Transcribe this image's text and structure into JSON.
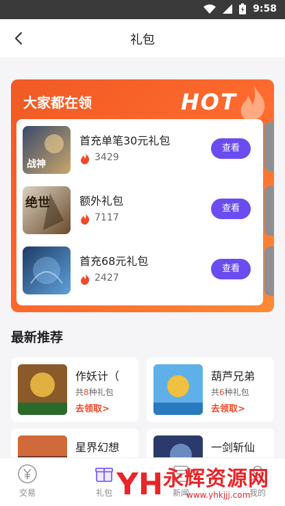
{
  "status_bar": {
    "time": "9:58"
  },
  "nav": {
    "title": "礼包"
  },
  "hot": {
    "heading": "大家都在领",
    "badge": "HOT",
    "items": [
      {
        "name": "首充单笔30元礼包",
        "count": "3429",
        "button": "查看",
        "art": "战神",
        "colors": [
          "#3b4a6b",
          "#c9a66b"
        ]
      },
      {
        "name": "额外礼包",
        "count": "7117",
        "button": "查看",
        "art": "绝世",
        "colors": [
          "#d9d2c2",
          "#6b4a2a"
        ]
      },
      {
        "name": "首充68元礼包",
        "count": "2427",
        "button": "查看",
        "art": "",
        "colors": [
          "#1d3b66",
          "#5fa0d8"
        ]
      }
    ]
  },
  "recommend": {
    "heading": "最新推荐",
    "items": [
      {
        "name": "作妖计（",
        "prefix": "共",
        "num": "8",
        "suffix": "种礼包",
        "claim": "去领取>",
        "colors": [
          "#8a5a2a",
          "#e0b040"
        ]
      },
      {
        "name": "葫芦兄弟",
        "prefix": "共",
        "num": "6",
        "suffix": "种礼包",
        "claim": "去领取>",
        "colors": [
          "#2a7ac0",
          "#f0c040"
        ]
      },
      {
        "name": "星界幻想",
        "colors": [
          "#7a3a2a",
          "#d06a3a"
        ]
      },
      {
        "name": "一剑斩仙",
        "colors": [
          "#2a3a6a",
          "#6a8ac0"
        ]
      }
    ]
  },
  "tabbar": {
    "items": [
      {
        "label": "交易",
        "icon": "yen-coin-icon"
      },
      {
        "label": "礼包",
        "icon": "gift-icon"
      },
      {
        "label": "新闻",
        "icon": "news-icon"
      },
      {
        "label": "我的",
        "icon": "profile-icon"
      }
    ]
  },
  "watermark": {
    "brand": "YH",
    "text": "永辉资源网",
    "url": "www.yhkjjj.com"
  },
  "colors": {
    "accent": "#6a4cf0",
    "hot_bg": "#f05a24",
    "claim": "#f04a2a"
  }
}
